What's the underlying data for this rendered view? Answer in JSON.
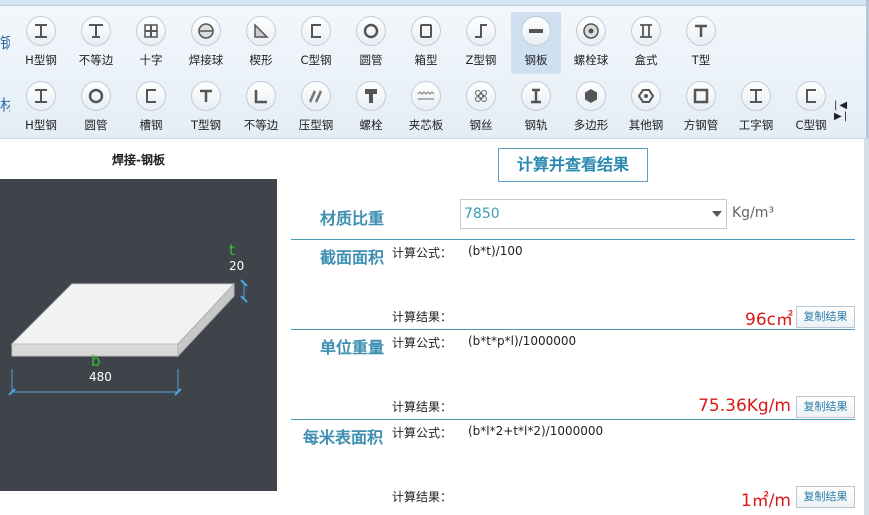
{
  "toolbar": {
    "side_glyphs_top": "钢",
    "side_glyphs_bottom": "材",
    "row1": [
      {
        "label": "H型钢",
        "icon": "h-beam-icon"
      },
      {
        "label": "不等边",
        "icon": "unequal-angle-icon"
      },
      {
        "label": "十字",
        "icon": "cross-icon"
      },
      {
        "label": "焊接球",
        "icon": "welded-ball-icon"
      },
      {
        "label": "楔形",
        "icon": "wedge-icon"
      },
      {
        "label": "C型钢",
        "icon": "c-channel-icon"
      },
      {
        "label": "圆管",
        "icon": "round-pipe-icon"
      },
      {
        "label": "箱型",
        "icon": "box-section-icon"
      },
      {
        "label": "Z型钢",
        "icon": "z-section-icon"
      },
      {
        "label": "钢板",
        "icon": "steel-plate-icon",
        "active": true
      },
      {
        "label": "螺栓球",
        "icon": "bolt-ball-icon"
      },
      {
        "label": "盒式",
        "icon": "box-type-icon"
      },
      {
        "label": "T型",
        "icon": "t-section-icon"
      }
    ],
    "row2": [
      {
        "label": "H型钢",
        "icon": "h-beam-icon"
      },
      {
        "label": "圆管",
        "icon": "round-pipe-icon"
      },
      {
        "label": "槽钢",
        "icon": "channel-icon"
      },
      {
        "label": "T型钢",
        "icon": "t-section-icon"
      },
      {
        "label": "不等边",
        "icon": "angle-icon"
      },
      {
        "label": "压型钢",
        "icon": "profiled-steel-icon"
      },
      {
        "label": "螺栓",
        "icon": "bolt-icon"
      },
      {
        "label": "夹芯板",
        "icon": "sandwich-panel-icon"
      },
      {
        "label": "钢丝",
        "icon": "steel-wire-icon"
      },
      {
        "label": "钢轨",
        "icon": "rail-icon"
      },
      {
        "label": "多边形",
        "icon": "polygon-icon"
      },
      {
        "label": "其他钢",
        "icon": "other-steel-icon"
      },
      {
        "label": "方钢管",
        "icon": "square-pipe-icon"
      },
      {
        "label": "工字钢",
        "icon": "i-beam-icon"
      },
      {
        "label": "C型钢",
        "icon": "c-channel-icon"
      }
    ],
    "nav": "|◀ ▶|"
  },
  "left": {
    "title": "焊接-钢板",
    "dim_t_letter": "t",
    "dim_t_value": "20",
    "dim_b_letter": "b",
    "dim_b_value": "480"
  },
  "right": {
    "calc_button": "计算并查看结果",
    "density": {
      "label": "材质比重",
      "value": "7850",
      "unit": "Kg/m³"
    },
    "sections": [
      {
        "title": "截面面积",
        "formula_label": "计算公式：",
        "formula": "(b*t)/100",
        "result_label": "计算结果：",
        "result": "96c㎡",
        "copy": "复制结果"
      },
      {
        "title": "单位重量",
        "formula_label": "计算公式：",
        "formula": "(b*t*p*l)/1000000",
        "result_label": "计算结果：",
        "result": "75.36Kg/m",
        "copy": "复制结果"
      },
      {
        "title": "每米表面积",
        "formula_label": "计算公式：",
        "formula": "(b*l*2+t*l*2)/1000000",
        "result_label": "计算结果：",
        "result": "1㎡/m",
        "copy": "复制结果"
      }
    ]
  },
  "colors": {
    "accent": "#3f8fb2",
    "result": "#d81818",
    "canvas_bg": "#3f434a",
    "dim_letter": "#2ec52e"
  }
}
